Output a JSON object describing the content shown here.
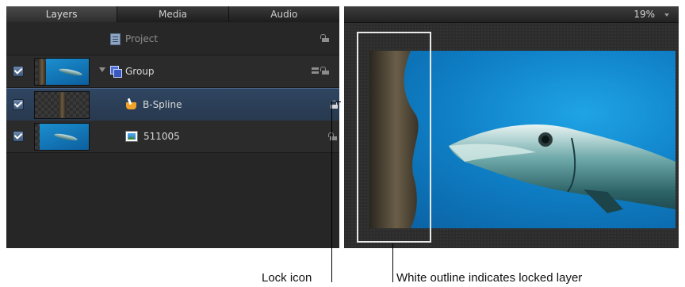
{
  "layers_panel": {
    "tabs": [
      {
        "label": "Layers"
      },
      {
        "label": "Media"
      },
      {
        "label": "Audio"
      }
    ],
    "rows": {
      "project": {
        "label": "Project"
      },
      "group": {
        "label": "Group",
        "checked": true
      },
      "bspline": {
        "label": "B-Spline",
        "checked": true,
        "selected": true,
        "locked": true
      },
      "image": {
        "label": "511005",
        "checked": true
      }
    }
  },
  "canvas": {
    "zoom": "19%"
  },
  "callouts": {
    "lock_icon": "Lock icon",
    "outline": "White outline indicates locked layer"
  },
  "colors": {
    "selected_row": "#2f4561",
    "panel_bg": "#262626",
    "sea": "#0f7fc6",
    "locked_outline": "#e8e8e8"
  }
}
